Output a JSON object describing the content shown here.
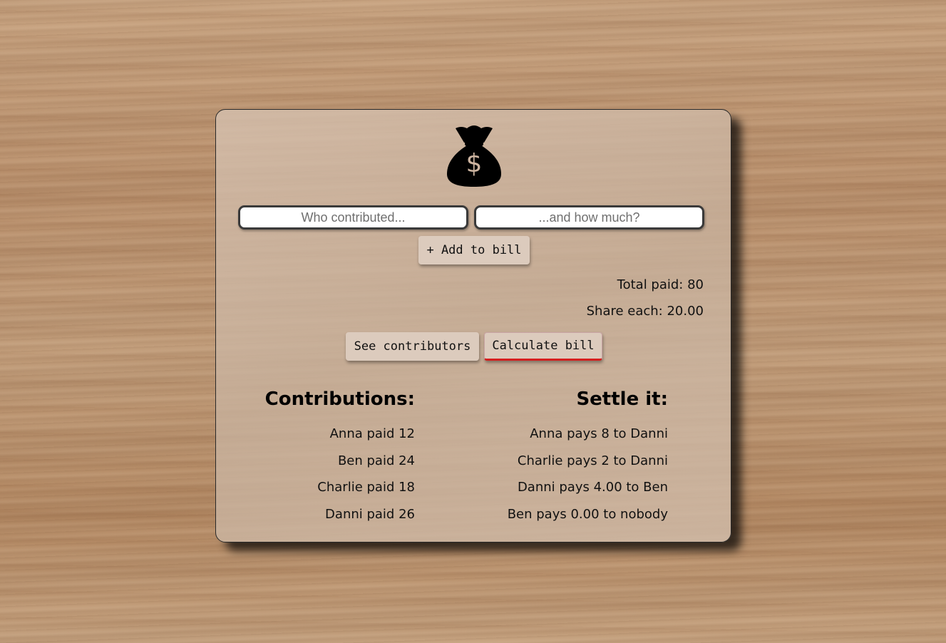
{
  "app": {
    "logo_icon": "money-bag-icon",
    "logo_glyph": "$"
  },
  "form": {
    "who_placeholder": "Who contributed...",
    "amount_placeholder": "...and how much?",
    "add_label": "+ Add to bill"
  },
  "summary": {
    "total_paid": "Total paid: 80",
    "share_each": "Share each: 20.00"
  },
  "actions": {
    "see_label": "See contributors",
    "calc_label": "Calculate bill",
    "active_underline_color": "#d51f1f"
  },
  "contributions": {
    "heading": "Contributions:",
    "items": [
      "Anna paid 12",
      "Ben paid 24",
      "Charlie paid 18",
      "Danni paid 26"
    ]
  },
  "settle": {
    "heading": "Settle it:",
    "items": [
      "Anna pays 8 to Danni",
      "Charlie pays 2 to Danni",
      "Danni pays 4.00 to Ben",
      "Ben pays 0.00 to nobody"
    ]
  }
}
